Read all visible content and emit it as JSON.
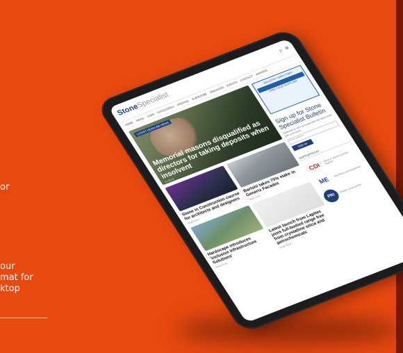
{
  "left_copy": {
    "line1": "or",
    "line2": "our",
    "line3": "mat for",
    "line4": "ktop"
  },
  "colors": {
    "background": "#e8490f",
    "brand_blue": "#1f3f7a"
  },
  "site": {
    "logo_bold": "Stone",
    "logo_light": "Specialist",
    "icons": [
      "search-icon",
      "menu-icon"
    ],
    "nav": [
      "Home",
      "News",
      "Jobs",
      "Categories",
      "Archive",
      "Subscribe",
      "Magazine",
      "Events",
      "Contact",
      "Awards"
    ],
    "hero": {
      "tag": "LATEST HEADLINE NEWS",
      "title": "Memorial masons disqualified as directors for taking deposits when insolvent",
      "meta": "21.06.22"
    },
    "cards": [
      {
        "title": "Stone in Construction course for architects and designers",
        "meta": "Read more"
      },
      {
        "title": "Bartoni takes 75% stake in Generix Facades",
        "meta": "Read more"
      },
      {
        "title": "Hardscape introduces 'inclusive infrastructure Solutions'",
        "meta": "Read more"
      },
      {
        "title": "Latest launch from Lapitec joins full-bodied range free from crystalline silica and petrochemicals",
        "meta": "Read more"
      }
    ],
    "ad": {
      "line1": "INDUSTRY DIRECTORY",
      "line2": "FIND YOUR SUPPLIER"
    },
    "signup": {
      "title": "Sign up for Stone Specialist Bulletin",
      "text": "Subscribe to stay up to date with the latest news, jobs and events",
      "email_placeholder": "Email address",
      "button": "Sign up"
    },
    "partners_title": "SUPPORTED BY",
    "partners": [
      {
        "logo": "CDI",
        "text": "Stone & natural products supplier"
      },
      {
        "logo": "ME",
        "text": "Machinery and equipment"
      },
      {
        "logo": "PRI",
        "text": "Premier stone partner"
      }
    ]
  }
}
